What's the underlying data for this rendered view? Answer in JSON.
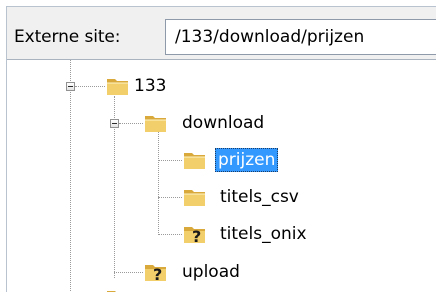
{
  "path_bar": {
    "label": "Externe site:",
    "value": "/133/download/prijzen"
  },
  "tree": {
    "nodes": [
      {
        "label": "133",
        "icon": "folder-icon",
        "state": "expanded"
      },
      {
        "label": "download",
        "icon": "folder-icon",
        "state": "expanded"
      },
      {
        "label": "prijzen",
        "icon": "folder-icon",
        "state": "selected"
      },
      {
        "label": "titels_csv",
        "icon": "folder-icon",
        "state": "normal"
      },
      {
        "label": "titels_onix",
        "icon": "unknown-folder-icon",
        "state": "normal"
      },
      {
        "label": "upload",
        "icon": "unknown-folder-icon",
        "state": "normal"
      }
    ]
  },
  "colors": {
    "selection": "#3399ff",
    "folder": "#e8c25a",
    "question": "#1a1a1a"
  }
}
